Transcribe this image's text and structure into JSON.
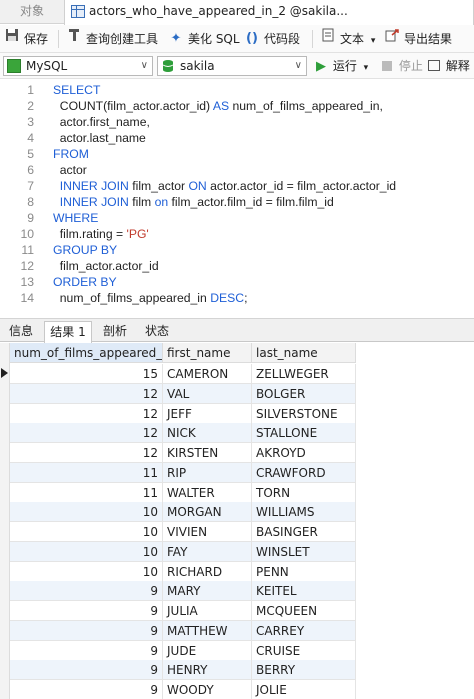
{
  "tabs": {
    "objects": "对象",
    "query": "actors_who_have_appeared_in_2 @sakila..."
  },
  "toolbar": {
    "save": "保存",
    "query_builder": "查询创建工具",
    "beautify": "美化 SQL",
    "code_snippet": "代码段",
    "text": "文本",
    "export": "导出结果"
  },
  "connection": {
    "server": "MySQL",
    "database": "sakila",
    "run": "运行",
    "stop": "停止",
    "explain": "解释"
  },
  "editor": {
    "lines": [
      {
        "n": "1",
        "parts": [
          {
            "t": "SELECT",
            "c": "kw"
          }
        ]
      },
      {
        "n": "2",
        "parts": [
          {
            "t": "  COUNT(film_actor.actor_id) ",
            "c": "tx"
          },
          {
            "t": "AS",
            "c": "kw"
          },
          {
            "t": " num_of_films_appeared_in,",
            "c": "tx"
          }
        ]
      },
      {
        "n": "3",
        "parts": [
          {
            "t": "  actor.first_name,",
            "c": "tx"
          }
        ]
      },
      {
        "n": "4",
        "parts": [
          {
            "t": "  actor.last_name",
            "c": "tx"
          }
        ]
      },
      {
        "n": "5",
        "parts": [
          {
            "t": "FROM",
            "c": "kw"
          }
        ]
      },
      {
        "n": "6",
        "parts": [
          {
            "t": "  actor",
            "c": "tx"
          }
        ]
      },
      {
        "n": "7",
        "parts": [
          {
            "t": "  INNER JOIN",
            "c": "kw"
          },
          {
            "t": " film_actor ",
            "c": "tx"
          },
          {
            "t": "ON",
            "c": "kw"
          },
          {
            "t": " actor.actor_id = film_actor.actor_id",
            "c": "tx"
          }
        ]
      },
      {
        "n": "8",
        "parts": [
          {
            "t": "  INNER JOIN",
            "c": "kw"
          },
          {
            "t": " film ",
            "c": "tx"
          },
          {
            "t": "on",
            "c": "kw"
          },
          {
            "t": " film_actor.film_id = film.film_id",
            "c": "tx"
          }
        ]
      },
      {
        "n": "9",
        "parts": [
          {
            "t": "WHERE",
            "c": "kw"
          }
        ]
      },
      {
        "n": "10",
        "parts": [
          {
            "t": "  film.rating = ",
            "c": "tx"
          },
          {
            "t": "'PG'",
            "c": "str"
          }
        ]
      },
      {
        "n": "11",
        "parts": [
          {
            "t": "GROUP BY",
            "c": "kw"
          }
        ]
      },
      {
        "n": "12",
        "parts": [
          {
            "t": "  film_actor.actor_id",
            "c": "tx"
          }
        ]
      },
      {
        "n": "13",
        "parts": [
          {
            "t": "ORDER BY",
            "c": "kw"
          }
        ]
      },
      {
        "n": "14",
        "parts": [
          {
            "t": "  num_of_films_appeared_in ",
            "c": "tx"
          },
          {
            "t": "DESC",
            "c": "kw"
          },
          {
            "t": ";",
            "c": "tx"
          }
        ]
      }
    ]
  },
  "result_tabs": [
    "信息",
    "结果 1",
    "剖析",
    "状态"
  ],
  "grid": {
    "columns": [
      "num_of_films_appeared_in",
      "first_name",
      "last_name"
    ],
    "rows": [
      [
        "15",
        "CAMERON",
        "ZELLWEGER"
      ],
      [
        "12",
        "VAL",
        "BOLGER"
      ],
      [
        "12",
        "JEFF",
        "SILVERSTONE"
      ],
      [
        "12",
        "NICK",
        "STALLONE"
      ],
      [
        "12",
        "KIRSTEN",
        "AKROYD"
      ],
      [
        "11",
        "RIP",
        "CRAWFORD"
      ],
      [
        "11",
        "WALTER",
        "TORN"
      ],
      [
        "10",
        "MORGAN",
        "WILLIAMS"
      ],
      [
        "10",
        "VIVIEN",
        "BASINGER"
      ],
      [
        "10",
        "FAY",
        "WINSLET"
      ],
      [
        "10",
        "RICHARD",
        "PENN"
      ],
      [
        "9",
        "MARY",
        "KEITEL"
      ],
      [
        "9",
        "JULIA",
        "MCQUEEN"
      ],
      [
        "9",
        "MATTHEW",
        "CARREY"
      ],
      [
        "9",
        "JUDE",
        "CRUISE"
      ],
      [
        "9",
        "HENRY",
        "BERRY"
      ],
      [
        "9",
        "WOODY",
        "JOLIE"
      ]
    ]
  },
  "colors": {
    "keyword": "#1f5fd6",
    "string": "#c0392b",
    "run_green": "#2e9e3a"
  }
}
